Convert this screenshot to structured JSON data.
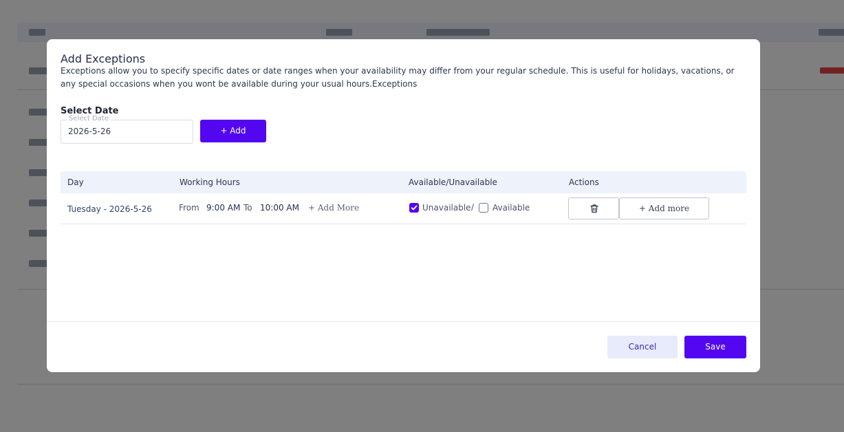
{
  "modal": {
    "title": "Add Exceptions",
    "description": "Exceptions allow you to specify specific dates or date ranges when your availability may differ from your regular schedule. This is useful for holidays, vacations, or any special occasions when you wont be available during your usual hours.Exceptions",
    "select_date_heading": "Select Date",
    "date_field": {
      "float_label": "Select Date",
      "value": "2026-5-26"
    },
    "add_button": "+ Add",
    "table": {
      "headers": [
        "Day",
        "Working Hours",
        "Available/Unavailable",
        "Actions"
      ],
      "rows": [
        {
          "day": "Tuesday - 2026-5-26",
          "from_label": "From",
          "from_time": "9:00 AM",
          "to_label": "To",
          "to_time": "10:00 AM",
          "add_more_link": "+  Add  More",
          "unavailable_label": "Unavailable",
          "unavailable_checked": true,
          "separator": "/",
          "available_label": "Available",
          "available_checked": false,
          "delete_icon": "trash-icon",
          "add_more_button": "+  Add  more"
        }
      ]
    },
    "footer": {
      "cancel": "Cancel",
      "save": "Save"
    }
  },
  "colors": {
    "primary": "#5207f0",
    "overlay": "rgba(0,0,0,0.5)",
    "cancel_bg": "#e7ebfb"
  }
}
